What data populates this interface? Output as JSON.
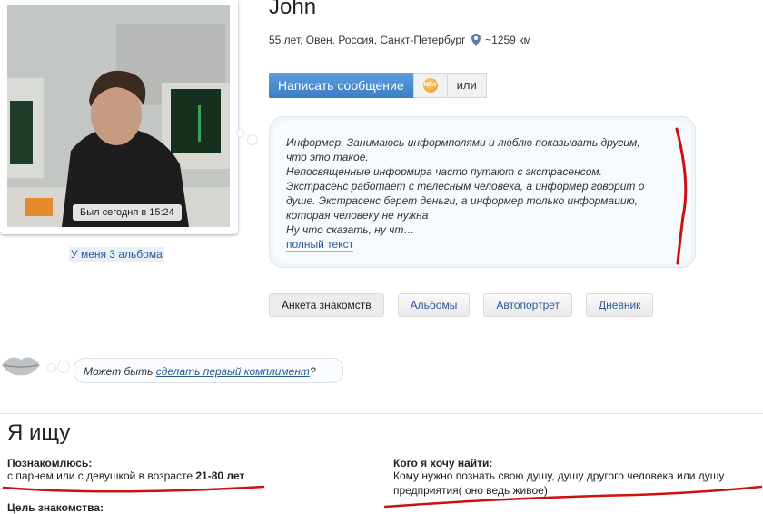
{
  "profile": {
    "name": "John",
    "details": "55 лет, Овен. Россия, Санкт-Петербург",
    "distance": "~1259 км",
    "last_seen": "Был сегодня в 15:24",
    "albums_link": "У меня 3 альбома"
  },
  "actions": {
    "message_button": "Написать сообщение",
    "gift_label": "NEW",
    "or_button": "или"
  },
  "about": {
    "lines": [
      "Информер. Занимаюсь информполями и люблю показывать другим,",
      "что это такое.",
      "Непосвященные информира часто путают с экстрасенсом.",
      "Экстрасенс работает с телесным человека, а информер говорит о",
      "душе. Экстрасенс берет деньги, а информер только информацию,",
      "которая человеку не нужна",
      "Ну что сказать, ну чт…"
    ],
    "full_text_link": "полный текст"
  },
  "tabs": [
    {
      "label": "Анкета знакомств",
      "active": true
    },
    {
      "label": "Альбомы",
      "active": false
    },
    {
      "label": "Автопортрет",
      "active": false
    },
    {
      "label": "Дневник",
      "active": false
    }
  ],
  "compliment": {
    "prefix": "Может быть ",
    "link": "сделать первый комплимент",
    "suffix": "?"
  },
  "seeking": {
    "title": "Я ищу",
    "meet_label": "Познакомлюсь:",
    "meet_value": "с парнем или с девушкой в возрасте ",
    "meet_age": "21-80 лет",
    "find_label": "Кого я хочу найти:",
    "find_value_1": "Кому нужно познать свою душу, душу другого человека или душу",
    "find_value_2": "предприятия( оно ведь живое)",
    "goal_label": "Цель знакомства:"
  },
  "colors": {
    "link": "#2a5a9a",
    "button": "#3b7dc5",
    "annotation": "#cc1111"
  }
}
